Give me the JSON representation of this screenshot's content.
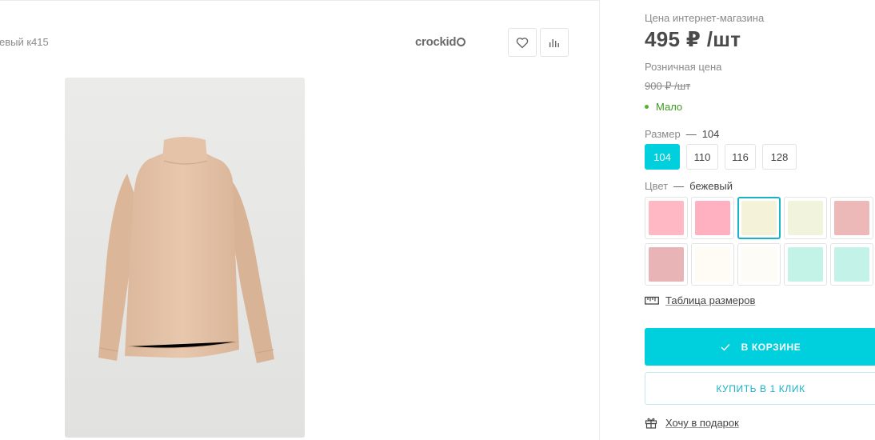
{
  "product": {
    "name_fragment": "евый к415",
    "brand": "crockid",
    "favorite_icon": "heart-icon",
    "compare_icon": "bar-chart-icon",
    "image_alt": "beige turtleneck"
  },
  "pricing": {
    "online_label": "Цена интернет-магазина",
    "online_price": "495 ₽ /шт",
    "retail_label": "Розничная цена",
    "retail_price": "900 ₽ /шт",
    "stock_status": "Мало",
    "stock_color": "#58b229"
  },
  "size": {
    "label": "Размер",
    "separator": "—",
    "selected": "104",
    "options": [
      "104",
      "110",
      "116",
      "128"
    ]
  },
  "color": {
    "label": "Цвет",
    "separator": "—",
    "selected": "бежевый",
    "swatches": [
      "#ffb8c4",
      "#ffb1c1",
      "#f4f3d9",
      "#f1f3dc",
      "#ecb8b8",
      "#e9b4b6",
      "#fefcf4",
      "#fdfcf6",
      "#c3f2e6",
      "#c3f2e8"
    ]
  },
  "links": {
    "size_table": "Таблица размеров",
    "gift": "Хочу в подарок"
  },
  "actions": {
    "in_cart": "В КОРЗИНЕ",
    "buy_one_click": "КУПИТЬ В 1 КЛИК"
  },
  "colors": {
    "accent": "#00cfdd",
    "accent_border": "#19b2c6"
  }
}
